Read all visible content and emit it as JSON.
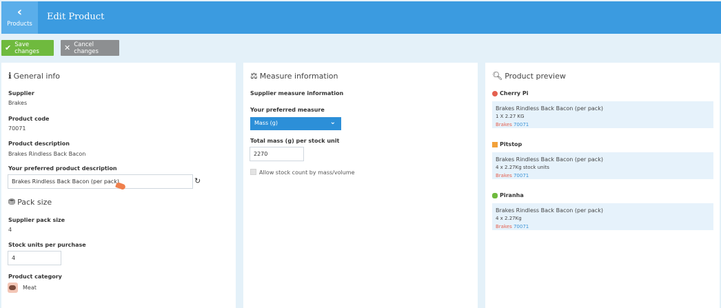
{
  "header": {
    "back_label": "Products",
    "title": "Edit Product"
  },
  "toolbar": {
    "save_label": "Save changes",
    "cancel_label": "Cancel changes"
  },
  "general": {
    "title": "General info",
    "supplier_label": "Supplier",
    "supplier_value": "Brakes",
    "code_label": "Product code",
    "code_value": "70071",
    "desc_label": "Product description",
    "desc_value": "Brakes Rindless Back Bacon",
    "pref_label": "Your preferred product description",
    "pref_value": "Brakes Rindless Back Bacon (per pack)"
  },
  "pack": {
    "title": "Pack size",
    "supplier_pack_label": "Supplier pack size",
    "supplier_pack_value": "4",
    "units_label": "Stock units per purchase",
    "units_value": "4",
    "category_label": "Product category",
    "category_value": "Meat"
  },
  "measure": {
    "title": "Measure information",
    "supplier_info_label": "Supplier measure information",
    "preferred_label": "Your preferred measure",
    "preferred_value": "Mass (g)",
    "total_label": "Total mass (g) per stock unit",
    "total_value": "2270",
    "allow_label": "Allow stock count by mass/volume"
  },
  "preview": {
    "title": "Product preview",
    "items": [
      {
        "brand": "Cherry Pi",
        "name": "Brakes Rindless Back Bacon (per pack)",
        "sub": "1 X 2.27 KG",
        "supplier": "Brakes",
        "code": "70071",
        "color": "#e4604f"
      },
      {
        "brand": "Pitstop",
        "name": "Brakes Rindless Back Bacon (per pack)",
        "sub": "4 x 2.27Kg stock units",
        "supplier": "Brakes",
        "code": "70071",
        "color": "#f2a13a"
      },
      {
        "brand": "Piranha",
        "name": "Brakes Rindless Back Bacon (per pack)",
        "sub": "4 x 2.27Kg",
        "supplier": "Brakes",
        "code": "70071",
        "color": "#6fba3e"
      }
    ]
  }
}
